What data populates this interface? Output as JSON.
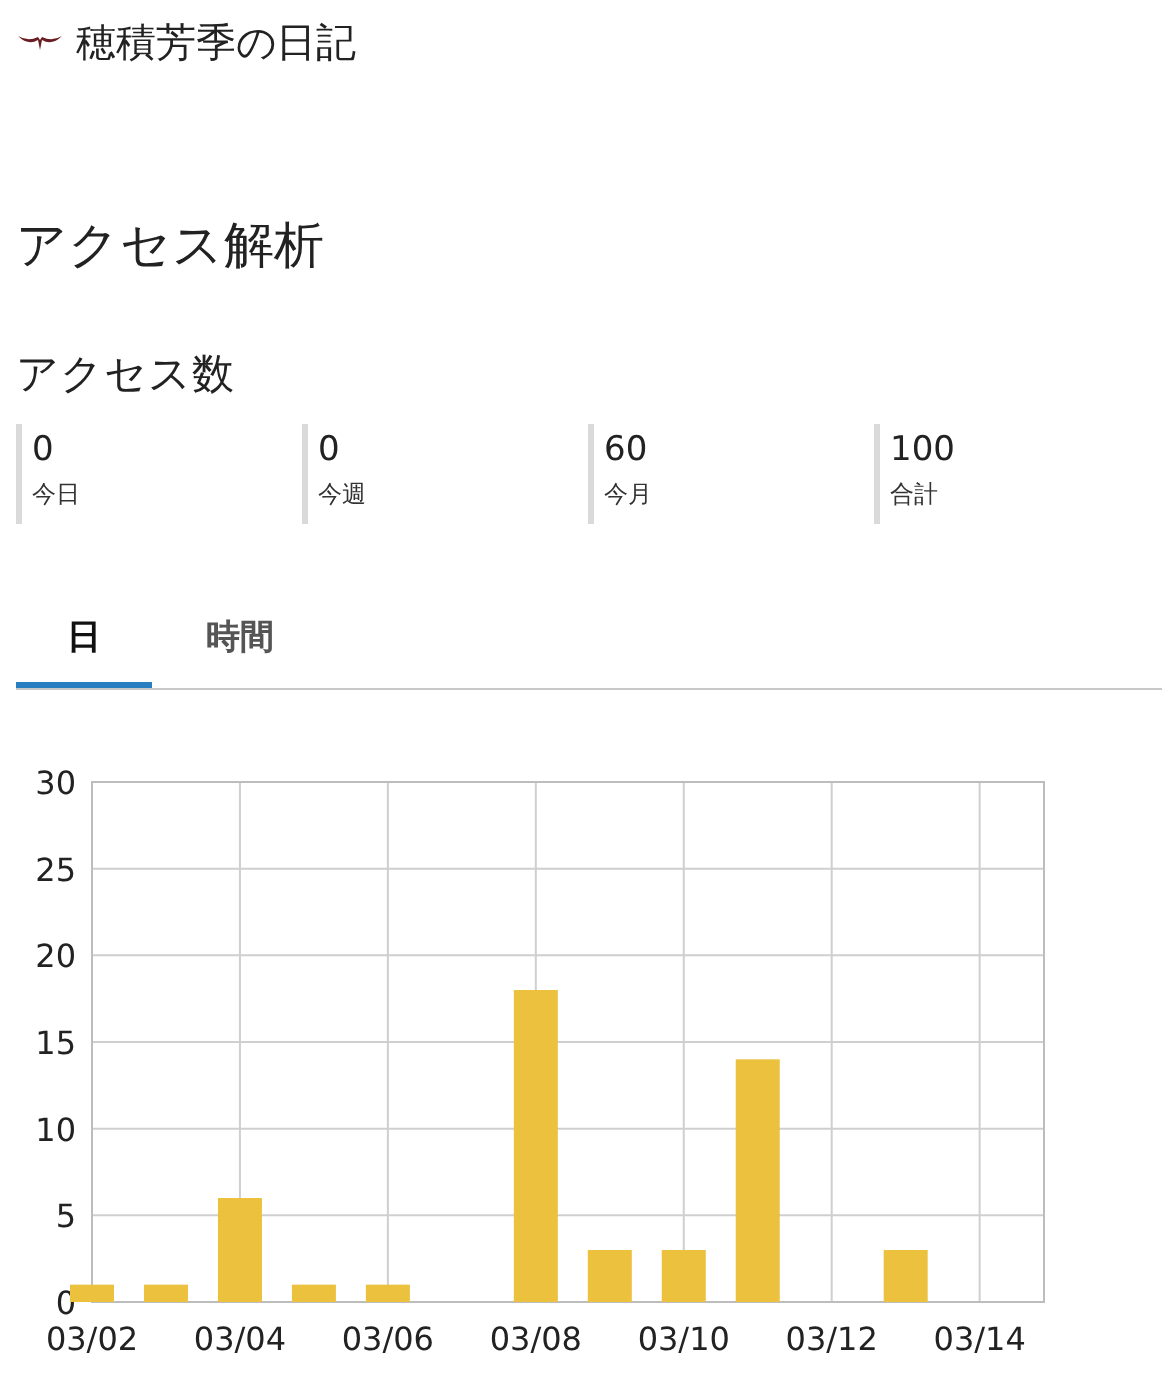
{
  "site": {
    "title": "穂積芳季の日記"
  },
  "page_title": "アクセス解析",
  "section_title": "アクセス数",
  "stats": [
    {
      "value": "0",
      "label": "今日"
    },
    {
      "value": "0",
      "label": "今週"
    },
    {
      "value": "60",
      "label": "今月"
    },
    {
      "value": "100",
      "label": "合計"
    }
  ],
  "tabs": [
    {
      "label": "日",
      "selected": true
    },
    {
      "label": "時間",
      "selected": false
    }
  ],
  "chart": {
    "chart_data": {
      "type": "bar",
      "categories": [
        "03/02",
        null,
        "03/04",
        null,
        "03/06",
        null,
        "03/08",
        null,
        "03/10",
        null,
        "03/12",
        null,
        "03/14"
      ],
      "series": [
        {
          "color": "#ebc13e",
          "values": [
            1,
            1,
            6,
            1,
            1,
            0,
            18,
            3,
            3,
            14,
            0,
            3,
            0
          ]
        }
      ],
      "grid": true,
      "ylim": [
        0,
        30
      ],
      "yticks": [
        0,
        5,
        10,
        15,
        20,
        25,
        30
      ]
    }
  }
}
